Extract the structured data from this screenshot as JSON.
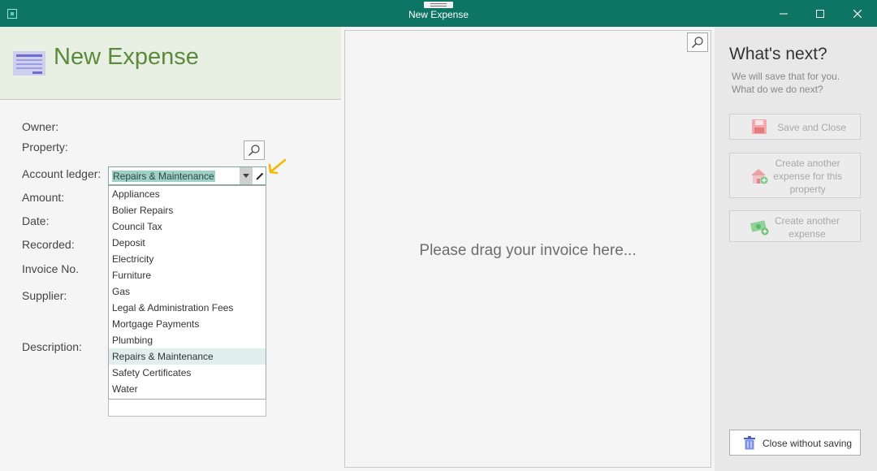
{
  "window": {
    "title": "New Expense",
    "minimize_icon": "minimize-icon",
    "maximize_icon": "maximize-icon",
    "close_icon": "close-icon"
  },
  "header": {
    "title": "New Expense",
    "icon": "expense-form-icon"
  },
  "form": {
    "labels": [
      "Owner:",
      "Property:",
      "Account ledger:",
      "Amount:",
      "Date:",
      "Recorded:",
      "Invoice No.",
      "Supplier:",
      "Description:"
    ],
    "account_ledger_value": "Repairs & Maintenance"
  },
  "ledger_options": [
    "Appliances",
    "Bolier Repairs",
    "Council Tax",
    "Deposit",
    "Electricity",
    "Furniture",
    "Gas",
    "Legal & Administration Fees",
    "Mortgage Payments",
    "Plumbing",
    "Repairs & Maintenance",
    "Safety Certificates",
    "Water"
  ],
  "ledger_selected_index": 10,
  "invoice": {
    "drop_message": "Please drag your invoice here..."
  },
  "next_panel": {
    "heading": "What's next?",
    "subtitle_line1": "We will save that for you.",
    "subtitle_line2": "What do we do next?",
    "save_close": "Save and Close",
    "create_property_line1": "Create another",
    "create_property_line2": "expense for this",
    "create_property_line3": "property",
    "create_another_line1": "Create another",
    "create_another_line2": "expense",
    "close_without_saving": "Close without saving"
  },
  "colors": {
    "titlebar": "#0e7463",
    "header_bg": "#e8f0e4",
    "header_text": "#5a8a3a",
    "selection": "#9fcfc5",
    "arrow": "#f5b800"
  }
}
